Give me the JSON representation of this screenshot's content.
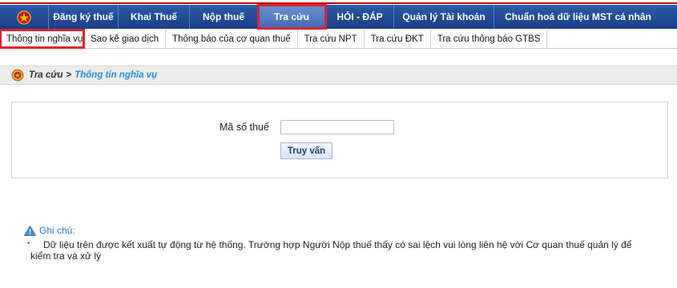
{
  "nav": {
    "items": [
      "Đăng ký thuế",
      "Khai Thuế",
      "Nộp thuế",
      "Tra cứu",
      "HỎI - ĐÁP",
      "Quản lý Tài khoản",
      "Chuẩn hoá dữ liệu MST cá nhân"
    ],
    "active_index": 3
  },
  "subnav": {
    "items": [
      "Thông tin nghĩa vụ",
      "Sao kê giao dịch",
      "Thông báo của cơ quan thuế",
      "Tra cứu NPT",
      "Tra cứu ĐKT",
      "Tra cứu thông báo GTBS"
    ],
    "active_index": 0
  },
  "breadcrumb": {
    "parent": "Tra cứu",
    "separator": ">",
    "current": "Thông tin nghĩa vụ"
  },
  "form": {
    "mst_label": "Mã số thuế",
    "mst_value": "",
    "query_button": "Truy vấn"
  },
  "note": {
    "title": "Ghi chú:",
    "text": "Dữ liệu trên được kết xuất tự động từ hệ thống. Trường hợp Người Nộp thuế thấy có sai lệch vui lòng liên hệ với Cơ quan thuế quản lý để kiểm tra và xử lý"
  },
  "colors": {
    "nav_bg": "#1a3f86",
    "highlight": "#e3202b",
    "link": "#2a8fd0"
  }
}
